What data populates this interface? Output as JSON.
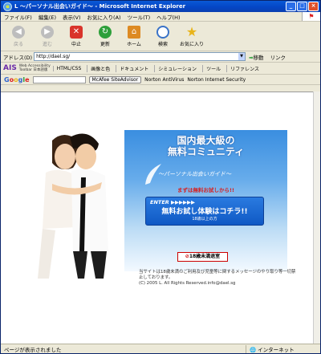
{
  "window": {
    "title": "L ～パーソナル出会いガイド～ - Microsoft Internet Explorer",
    "logo": "e"
  },
  "window_buttons": [
    "_",
    "□",
    "×"
  ],
  "menu": [
    "ファイル(F)",
    "編集(E)",
    "表示(V)",
    "お気に入り(A)",
    "ツール(T)",
    "ヘルプ(H)"
  ],
  "toolbar": {
    "back": "戻る",
    "forward": "進む",
    "stop": "中止",
    "refresh": "更新",
    "home": "ホーム",
    "search": "検索",
    "favorites": "お気に入り"
  },
  "address": {
    "label": "アドレス(D)",
    "value": "http://dael.sg/",
    "go": "移動",
    "links": "リンク"
  },
  "ais_bar": {
    "logo": "AIS",
    "sub1": "Web Accessibility",
    "sub2": "Toolbar 日本語版",
    "items": [
      "HTML/CSS",
      "画像と色",
      "ドキュメント",
      "シミュレーション",
      "ツール",
      "リファレンス"
    ]
  },
  "google_bar": {
    "logo": [
      "G",
      "o",
      "o",
      "g",
      "l",
      "e"
    ],
    "mcafee": "McAfee SiteAdvisor",
    "antivirus": "Norton AntiVirus",
    "security": "Norton Internet Security"
  },
  "page": {
    "heading_line1": "国内最大級の",
    "heading_line2": "無料コミュニティ",
    "subtitle": "～パーソナル出会いガイド～",
    "free_text": "まずは無料お試しから!!",
    "enter_label": "ENTER ▶▶▶▶▶▶",
    "enter_main": "無料お試し体験はコチラ!!",
    "enter_sub": "18歳以上の方",
    "under18": "18歳未満退室",
    "notice": "当サイトは18歳未満のご利用及び児童等に関するメッセージのやり取り等一切禁止しております。",
    "copyright": "(C) 2005 L. All Rights Reserved.info@dael.sg"
  },
  "status": {
    "text": "ページが表示されました",
    "zone": "インターネット"
  },
  "colors": {
    "title_bar": "#0446c6",
    "panel_top": "#3a8ee0",
    "accent_red": "#d62020",
    "enter_blue": "#0f58c4"
  }
}
